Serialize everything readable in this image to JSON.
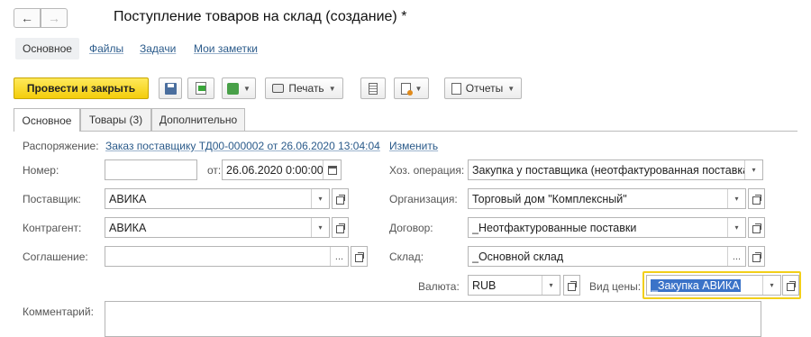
{
  "window": {
    "title": "Поступление товаров на склад (создание) *",
    "back_icon": "arrow-left-icon",
    "forward_icon": "arrow-right-icon"
  },
  "sections": [
    {
      "label": "Основное",
      "active": true
    },
    {
      "label": "Файлы",
      "active": false
    },
    {
      "label": "Задачи",
      "active": false
    },
    {
      "label": "Мои заметки",
      "active": false
    }
  ],
  "toolbar": {
    "post_close_label": "Провести и закрыть",
    "print_label": "Печать",
    "reports_label": "Отчеты",
    "accent": "#f3cd0b"
  },
  "tabs": [
    {
      "label": "Основное",
      "active": true
    },
    {
      "label": "Товары (3)",
      "active": false
    },
    {
      "label": "Дополнительно",
      "active": false
    }
  ],
  "form": {
    "order_label": "Распоряжение:",
    "order_link": "Заказ поставщику ТД00-000002 от 26.06.2020 13:04:04",
    "change_link": "Изменить",
    "number_label": "Номер:",
    "number_value": "",
    "from_label": "от:",
    "date_value": "26.06.2020  0:00:00",
    "supplier_label": "Поставщик:",
    "supplier_value": "АВИКА",
    "counterparty_label": "Контрагент:",
    "counterparty_value": "АВИКА",
    "agreement_label": "Соглашение:",
    "agreement_value": "",
    "operation_label": "Хоз. операция:",
    "operation_value": "Закупка у поставщика (неотфактурованная поставка)",
    "organization_label": "Организация:",
    "organization_value": "Торговый дом \"Комплексный\"",
    "contract_label": "Договор:",
    "contract_value": "_Неотфактурованные поставки",
    "warehouse_label": "Склад:",
    "warehouse_value": "_Основной склад",
    "currency_label": "Валюта:",
    "currency_value": "RUB",
    "price_type_label": "Вид цены:",
    "price_type_value": "_Закупка АВИКА",
    "comment_label": "Комментарий:",
    "comment_value": "",
    "dropdown_symbol": "▾",
    "ellipsis_symbol": "..."
  }
}
